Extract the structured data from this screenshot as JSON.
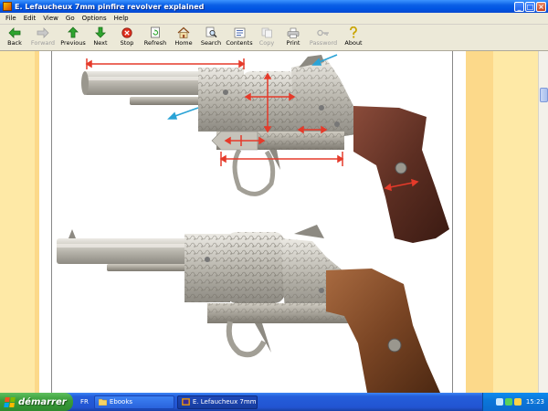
{
  "window": {
    "title": "E. Lefaucheux 7mm pinfire revolver explained",
    "buttons": {
      "minimize": "_",
      "maximize": "□",
      "close": "×"
    }
  },
  "menu": [
    "File",
    "Edit",
    "View",
    "Go",
    "Options",
    "Help"
  ],
  "toolbar": [
    {
      "label": "Back",
      "icon": "back-arrow-icon",
      "enabled": true
    },
    {
      "label": "Forward",
      "icon": "forward-arrow-icon",
      "enabled": false
    },
    {
      "label": "Previous",
      "icon": "up-arrow-icon",
      "enabled": true
    },
    {
      "label": "Next",
      "icon": "down-arrow-icon",
      "enabled": true
    },
    {
      "label": "Stop",
      "icon": "stop-icon",
      "enabled": true
    },
    {
      "label": "Refresh",
      "icon": "refresh-icon",
      "enabled": true
    },
    {
      "label": "Home",
      "icon": "home-icon",
      "enabled": true
    },
    {
      "label": "Search",
      "icon": "search-icon",
      "enabled": true
    },
    {
      "label": "Contents",
      "icon": "contents-icon",
      "enabled": true
    },
    {
      "label": "Copy",
      "icon": "copy-icon",
      "enabled": false
    },
    {
      "label": "Print",
      "icon": "print-icon",
      "enabled": true
    },
    {
      "label": "Password",
      "icon": "key-icon",
      "enabled": false
    },
    {
      "label": "About",
      "icon": "about-icon",
      "enabled": true
    }
  ],
  "taskbar": {
    "start_label": "démarrer",
    "language": "FR",
    "tasks": [
      {
        "label": "Ebooks",
        "icon": "folder-icon"
      },
      {
        "label": "E. Lefaucheux 7mm p...",
        "icon": "app-icon"
      }
    ],
    "clock": "15:23"
  },
  "colors": {
    "margin": "#fee9a6",
    "annotation_arrow_red": "#e53a2a",
    "annotation_arrow_cyan": "#2aa3d6"
  }
}
